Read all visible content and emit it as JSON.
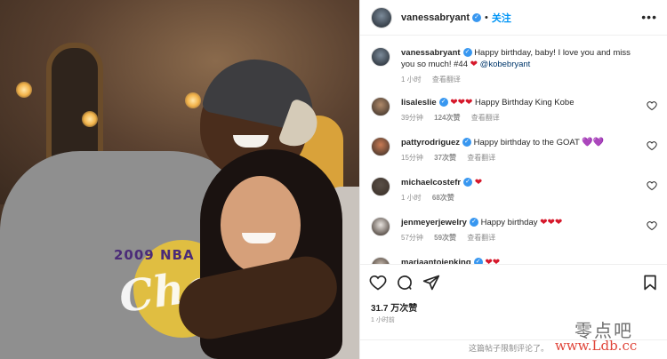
{
  "post": {
    "author": "vanessabryant",
    "follow_label": "关注",
    "separator": "•",
    "more_label": "•••"
  },
  "caption": {
    "user": "vanessabryant",
    "text": "Happy birthday, baby! I love you and miss you so much! #44",
    "mention": "@kobebryant",
    "time": "1 小时",
    "translate": "查看翻译"
  },
  "comments": [
    {
      "user": "lisaleslie",
      "text": "Happy Birthday King Kobe",
      "emoji": "❤❤❤",
      "emoji_pos": "before",
      "time": "39分钟",
      "likes": "124次赞",
      "translate": "查看翻译",
      "avatar_color": "#b08a6a"
    },
    {
      "user": "pattyrodriguez",
      "text": "Happy birthday to the GOAT",
      "emoji": "💜💜",
      "emoji_pos": "after",
      "time": "15分钟",
      "likes": "37次赞",
      "translate": "查看翻译",
      "avatar_color": "#c97b54"
    },
    {
      "user": "michaelcostefr",
      "text": "",
      "emoji": "❤",
      "emoji_pos": "after",
      "time": "1 小时",
      "likes": "68次赞",
      "translate": "",
      "avatar_color": "#5a5047"
    },
    {
      "user": "jenmeyerjewelry",
      "text": "Happy birthday",
      "emoji": "❤❤❤",
      "emoji_pos": "after",
      "time": "57分钟",
      "likes": "59次赞",
      "translate": "查看翻译",
      "avatar_color": "#e9e4df"
    },
    {
      "user": "mariaantoienking",
      "text": "",
      "emoji": "❤❤",
      "emoji_pos": "after",
      "time": "",
      "likes": "",
      "translate": "",
      "avatar_color": "#c4b8ac"
    }
  ],
  "engagement": {
    "likes": "31.7 万次赞",
    "time": "1 小时前",
    "comments_disabled": "这篇帖子限制评论了。"
  },
  "watermark": {
    "cn": "零点吧",
    "url": "www.Ldb.cc"
  },
  "photo": {
    "shirt_text": "2009 NBA",
    "shirt_script": "Cha"
  }
}
